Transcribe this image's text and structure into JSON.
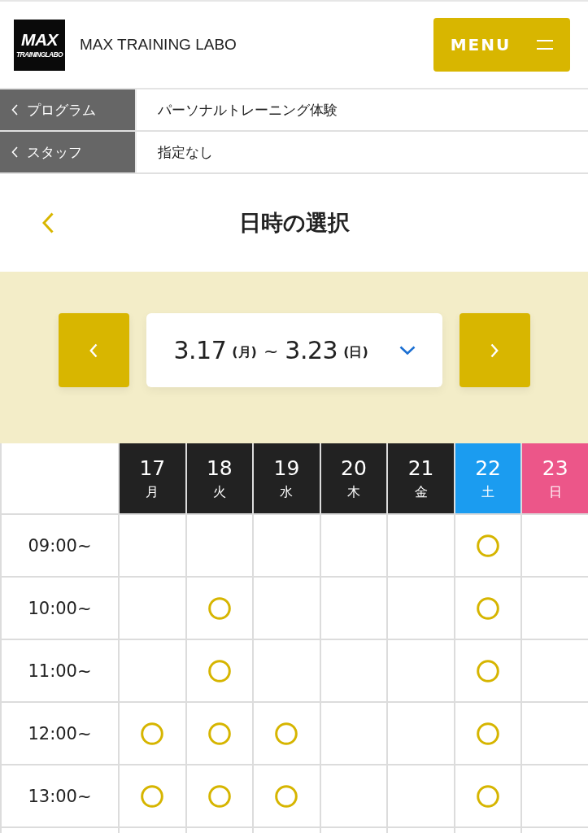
{
  "header": {
    "logo": {
      "line_1": "MAX",
      "line_2": "TRAININGLABO"
    },
    "site_name": "MAX TRAINING LABO",
    "menu_button": {
      "label": "MENU"
    }
  },
  "breadcrumbs": [
    {
      "label": "プログラム",
      "value": "パーソナルトレーニング体験"
    },
    {
      "label": "スタッフ",
      "value": "指定なし"
    }
  ],
  "page_title": "日時の選択",
  "week_selector": {
    "start_date": "3.17",
    "start_weekday": "(月)",
    "separator": "~",
    "end_date": "3.23",
    "end_weekday": "(日)"
  },
  "calendar": {
    "days": [
      {
        "date": "17",
        "weekday": "月",
        "color": "#222222"
      },
      {
        "date": "18",
        "weekday": "火",
        "color": "#222222"
      },
      {
        "date": "19",
        "weekday": "水",
        "color": "#222222"
      },
      {
        "date": "20",
        "weekday": "木",
        "color": "#222222"
      },
      {
        "date": "21",
        "weekday": "金",
        "color": "#222222"
      },
      {
        "date": "22",
        "weekday": "土",
        "color": "#1b9cf0"
      },
      {
        "date": "23",
        "weekday": "日",
        "color": "#ec5689"
      }
    ],
    "rows": [
      {
        "time": "09:00~",
        "available": [
          false,
          false,
          false,
          false,
          false,
          true,
          false
        ]
      },
      {
        "time": "10:00~",
        "available": [
          false,
          true,
          false,
          false,
          false,
          true,
          false
        ]
      },
      {
        "time": "11:00~",
        "available": [
          false,
          true,
          false,
          false,
          false,
          true,
          false
        ]
      },
      {
        "time": "12:00~",
        "available": [
          true,
          true,
          true,
          false,
          false,
          true,
          false
        ]
      },
      {
        "time": "13:00~",
        "available": [
          true,
          true,
          true,
          false,
          false,
          true,
          false
        ]
      }
    ]
  }
}
